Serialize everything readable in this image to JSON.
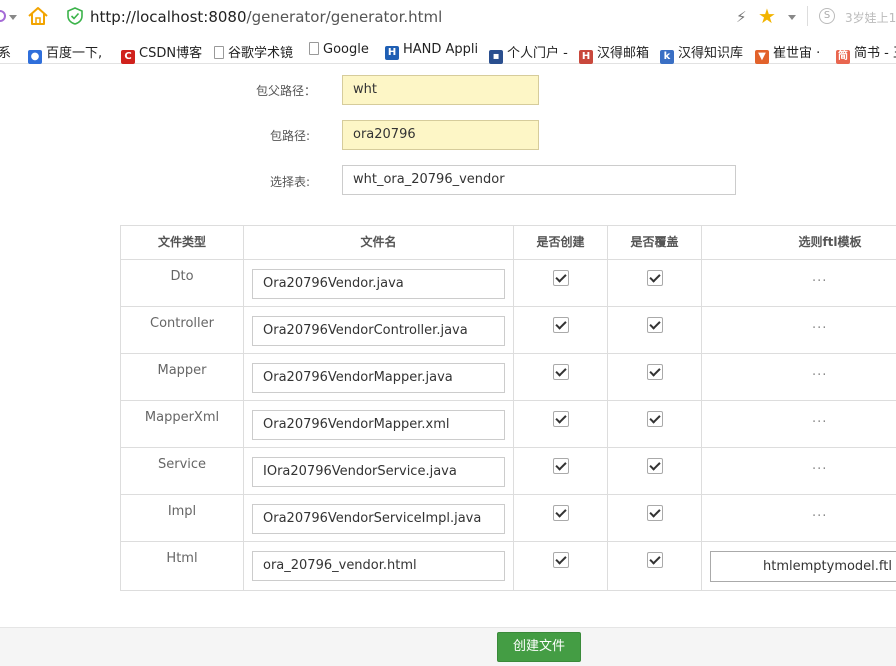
{
  "browser": {
    "url_host": "http://localhost:8080",
    "url_path": "/generator/generator.html",
    "side_text": "3岁娃上1",
    "bookmarks": [
      {
        "label": "系",
        "icon": "blank-icon"
      },
      {
        "label": "百度一下,",
        "icon": "baidu-paw-icon"
      },
      {
        "label": "CSDN博客",
        "icon": "csdn-icon"
      },
      {
        "label": "谷歌学术镜",
        "icon": "page-icon"
      },
      {
        "label": "Google",
        "icon": "page-icon"
      },
      {
        "label": "HAND Appli",
        "icon": "hand-icon"
      },
      {
        "label": "个人门户 -",
        "icon": "portal-icon"
      },
      {
        "label": "汉得邮箱",
        "icon": "mail-icon"
      },
      {
        "label": "汉得知识库",
        "icon": "kb-icon"
      },
      {
        "label": "崔世宙 ·",
        "icon": "gitlab-fox-icon"
      },
      {
        "label": "简书 - 王",
        "icon": "jianshu-icon"
      }
    ]
  },
  "form": {
    "parent_package_label": "包父路径：",
    "parent_package_value": "wht",
    "package_label": "包路径:",
    "package_value": "ora20796",
    "table_label": "选择表:",
    "table_value": "wht_ora_20796_vendor"
  },
  "table": {
    "headers": [
      "文件类型",
      "文件名",
      "是否创建",
      "是否覆盖",
      "选则ftl模板"
    ],
    "rows": [
      {
        "type": "Dto",
        "file": "Ora20796Vendor.java",
        "create": true,
        "cover": true,
        "template": "..."
      },
      {
        "type": "Controller",
        "file": "Ora20796VendorController.java",
        "create": true,
        "cover": true,
        "template": "..."
      },
      {
        "type": "Mapper",
        "file": "Ora20796VendorMapper.java",
        "create": true,
        "cover": true,
        "template": "..."
      },
      {
        "type": "MapperXml",
        "file": "Ora20796VendorMapper.xml",
        "create": true,
        "cover": true,
        "template": "..."
      },
      {
        "type": "Service",
        "file": "IOra20796VendorService.java",
        "create": true,
        "cover": true,
        "template": "..."
      },
      {
        "type": "Impl",
        "file": "Ora20796VendorServiceImpl.java",
        "create": true,
        "cover": true,
        "template": "..."
      },
      {
        "type": "Html",
        "file": "ora_20796_vendor.html",
        "create": true,
        "cover": true,
        "template": "htmlemptymodel.ftl"
      }
    ]
  },
  "actions": {
    "create_button": "创建文件"
  },
  "colors": {
    "yellow_input": "#fdf6c6",
    "green_button": "#449d44",
    "star": "#f2b400"
  }
}
